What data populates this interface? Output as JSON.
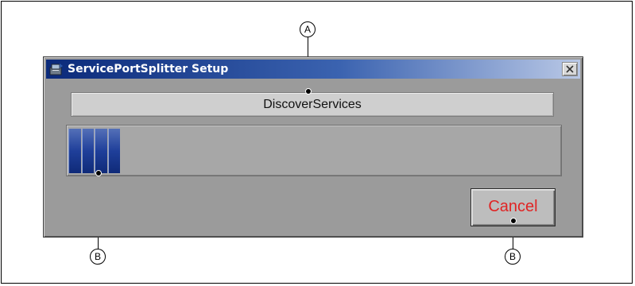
{
  "window": {
    "title": "ServicePortSplitter Setup",
    "title_icon": "installer-app-icon",
    "close_icon": "close-x-icon"
  },
  "status": {
    "text": "DiscoverServices"
  },
  "progress": {
    "level_fraction": 0.11,
    "segments_shown": 4,
    "fill_color": "#1f3f9a"
  },
  "buttons": {
    "cancel_label": "Cancel",
    "cancel_text_color": "#e02424"
  },
  "callouts": {
    "a_label": "A",
    "b_label": "B",
    "b2_label": "B"
  }
}
